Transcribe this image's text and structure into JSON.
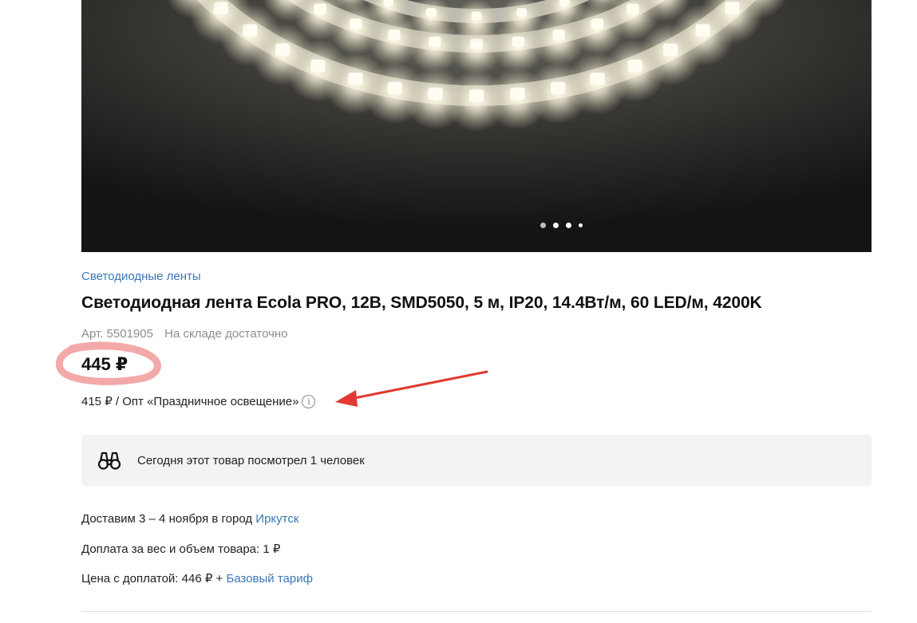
{
  "product": {
    "category": "Светодиодные ленты",
    "title": "Светодиодная лента Ecola PRO, 12В, SMD5050, 5 м, IP20, 14.4Вт/м, 60 LED/м, 4200K",
    "article": "Арт. 5501905",
    "stock": "На складе достаточно",
    "price": "445 ₽",
    "wholesale_price": "415 ₽ / Опт «Праздничное освещение»",
    "info_icon": "i"
  },
  "gallery": {
    "dots_count": 4,
    "active_dot": 2
  },
  "views_box": {
    "icon": "binoculars-icon",
    "text": "Сегодня этот товар посмотрел 1 человек"
  },
  "delivery": {
    "prefix": "Доставим 3 – 4 ноября в город ",
    "city": "Иркутск",
    "surcharge": "Доплата за вес и объем товара: 1 ₽",
    "total_prefix": "Цена с доплатой: 446 ₽ + ",
    "tariff": "Базовый тариф"
  },
  "colors": {
    "link": "#3a78b8",
    "annotation_red": "#e03a32",
    "highlight_pink": "#f2a0a0"
  }
}
